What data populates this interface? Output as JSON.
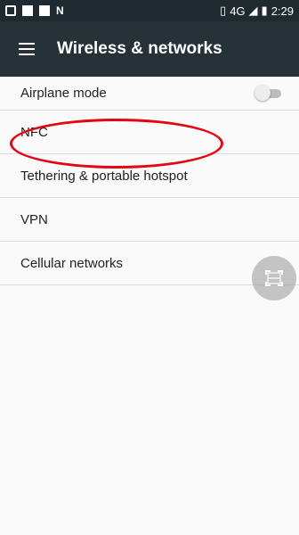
{
  "status_bar": {
    "network": "4G",
    "time": "2:29"
  },
  "app_bar": {
    "title": "Wireless & networks",
    "menu_icon": "hamburger-menu-icon"
  },
  "settings": {
    "items": [
      {
        "label": "Airplane mode",
        "toggle": false
      },
      {
        "label": "NFC"
      },
      {
        "label": "Tethering & portable hotspot"
      },
      {
        "label": "VPN"
      },
      {
        "label": "Cellular networks"
      }
    ]
  },
  "floating_button": {
    "icon": "screenshot-capture-icon"
  },
  "colors": {
    "app_bar": "#263238",
    "status_bar": "#1f2a30",
    "highlight": "#e30613",
    "background": "#fafafa"
  }
}
